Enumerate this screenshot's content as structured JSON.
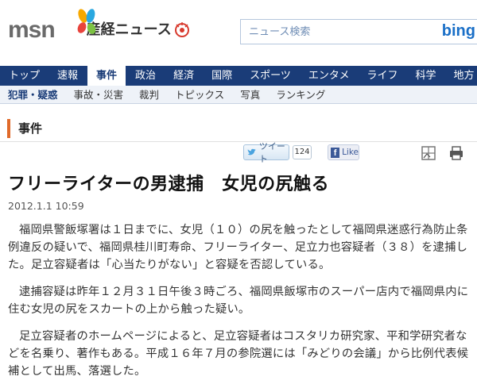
{
  "header": {
    "brand": "msn",
    "site_title": "産経ニュース",
    "search_placeholder": "ニュース検索",
    "search_engine": "bing"
  },
  "nav": {
    "items": [
      {
        "label": "トップ",
        "active": false
      },
      {
        "label": "速報",
        "active": false
      },
      {
        "label": "事件",
        "active": true
      },
      {
        "label": "政治",
        "active": false
      },
      {
        "label": "経済",
        "active": false
      },
      {
        "label": "国際",
        "active": false
      },
      {
        "label": "スポーツ",
        "active": false
      },
      {
        "label": "エンタメ",
        "active": false
      },
      {
        "label": "ライフ",
        "active": false
      },
      {
        "label": "科学",
        "active": false
      },
      {
        "label": "地方",
        "active": false
      }
    ]
  },
  "subnav": {
    "items": [
      {
        "label": "犯罪・疑惑",
        "active": true
      },
      {
        "label": "事故・災害",
        "active": false
      },
      {
        "label": "裁判",
        "active": false
      },
      {
        "label": "トピックス",
        "active": false
      },
      {
        "label": "写真",
        "active": false
      },
      {
        "label": "ランキング",
        "active": false
      }
    ]
  },
  "section": {
    "title": "事件"
  },
  "share": {
    "tweet_label": "ツイート",
    "tweet_count": "124",
    "like_label": "Like"
  },
  "article": {
    "headline": "フリーライターの男逮捕　女児の尻触る",
    "datetime": "2012.1.1 10:59",
    "paragraphs": [
      "福岡県警飯塚署は１日までに、女児（１０）の尻を触ったとして福岡県迷惑行為防止条例違反の疑いで、福岡県桂川町寿命、フリーライター、足立力也容疑者（３８）を逮捕した。足立容疑者は「心当たりがない」と容疑を否認している。",
      "逮捕容疑は昨年１２月３１日午後３時ごろ、福岡県飯塚市のスーパー店内で福岡県内に住む女児の尻をスカートの上から触った疑い。",
      "足立容疑者のホームページによると、足立容疑者はコスタリカ研究家、平和学研究者などを名乗り、著作もある。平成１６年７月の参院選には「みどりの会議」から比例代表候補として出馬、落選した。"
    ]
  },
  "colors": {
    "nav_bg": "#1a3c78",
    "accent": "#e06a2a",
    "bing_blue": "#1a6fc7"
  }
}
